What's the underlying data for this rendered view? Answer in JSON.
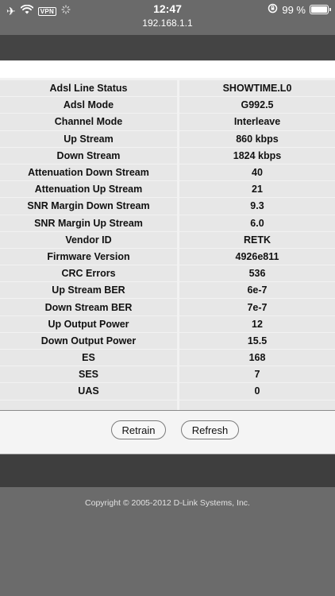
{
  "statusbar": {
    "vpn_label": "VPN",
    "time": "12:47",
    "url": "192.168.1.1",
    "battery_text": "99 %",
    "battery_level": 0.99
  },
  "rows": [
    {
      "label": "Adsl Line Status",
      "value": "SHOWTIME.L0"
    },
    {
      "label": "Adsl Mode",
      "value": "G992.5"
    },
    {
      "label": "Channel Mode",
      "value": "Interleave"
    },
    {
      "label": "Up Stream",
      "value": "860 kbps"
    },
    {
      "label": "Down Stream",
      "value": "1824 kbps"
    },
    {
      "label": "Attenuation Down Stream",
      "value": "40"
    },
    {
      "label": "Attenuation Up Stream",
      "value": "21"
    },
    {
      "label": "SNR Margin Down Stream",
      "value": "9.3"
    },
    {
      "label": "SNR Margin Up Stream",
      "value": "6.0"
    },
    {
      "label": "Vendor ID",
      "value": "RETK"
    },
    {
      "label": "Firmware Version",
      "value": "4926e811"
    },
    {
      "label": "CRC Errors",
      "value": "536"
    },
    {
      "label": "Up Stream BER",
      "value": "6e-7"
    },
    {
      "label": "Down Stream BER",
      "value": "7e-7"
    },
    {
      "label": "Up Output Power",
      "value": "12"
    },
    {
      "label": "Down Output Power",
      "value": "15.5"
    },
    {
      "label": "ES",
      "value": "168"
    },
    {
      "label": "SES",
      "value": "7"
    },
    {
      "label": "UAS",
      "value": "0"
    }
  ],
  "buttons": {
    "retrain": "Retrain",
    "refresh": "Refresh"
  },
  "footer": {
    "copyright": "Copyright © 2005-2012 D-Link Systems, Inc."
  }
}
